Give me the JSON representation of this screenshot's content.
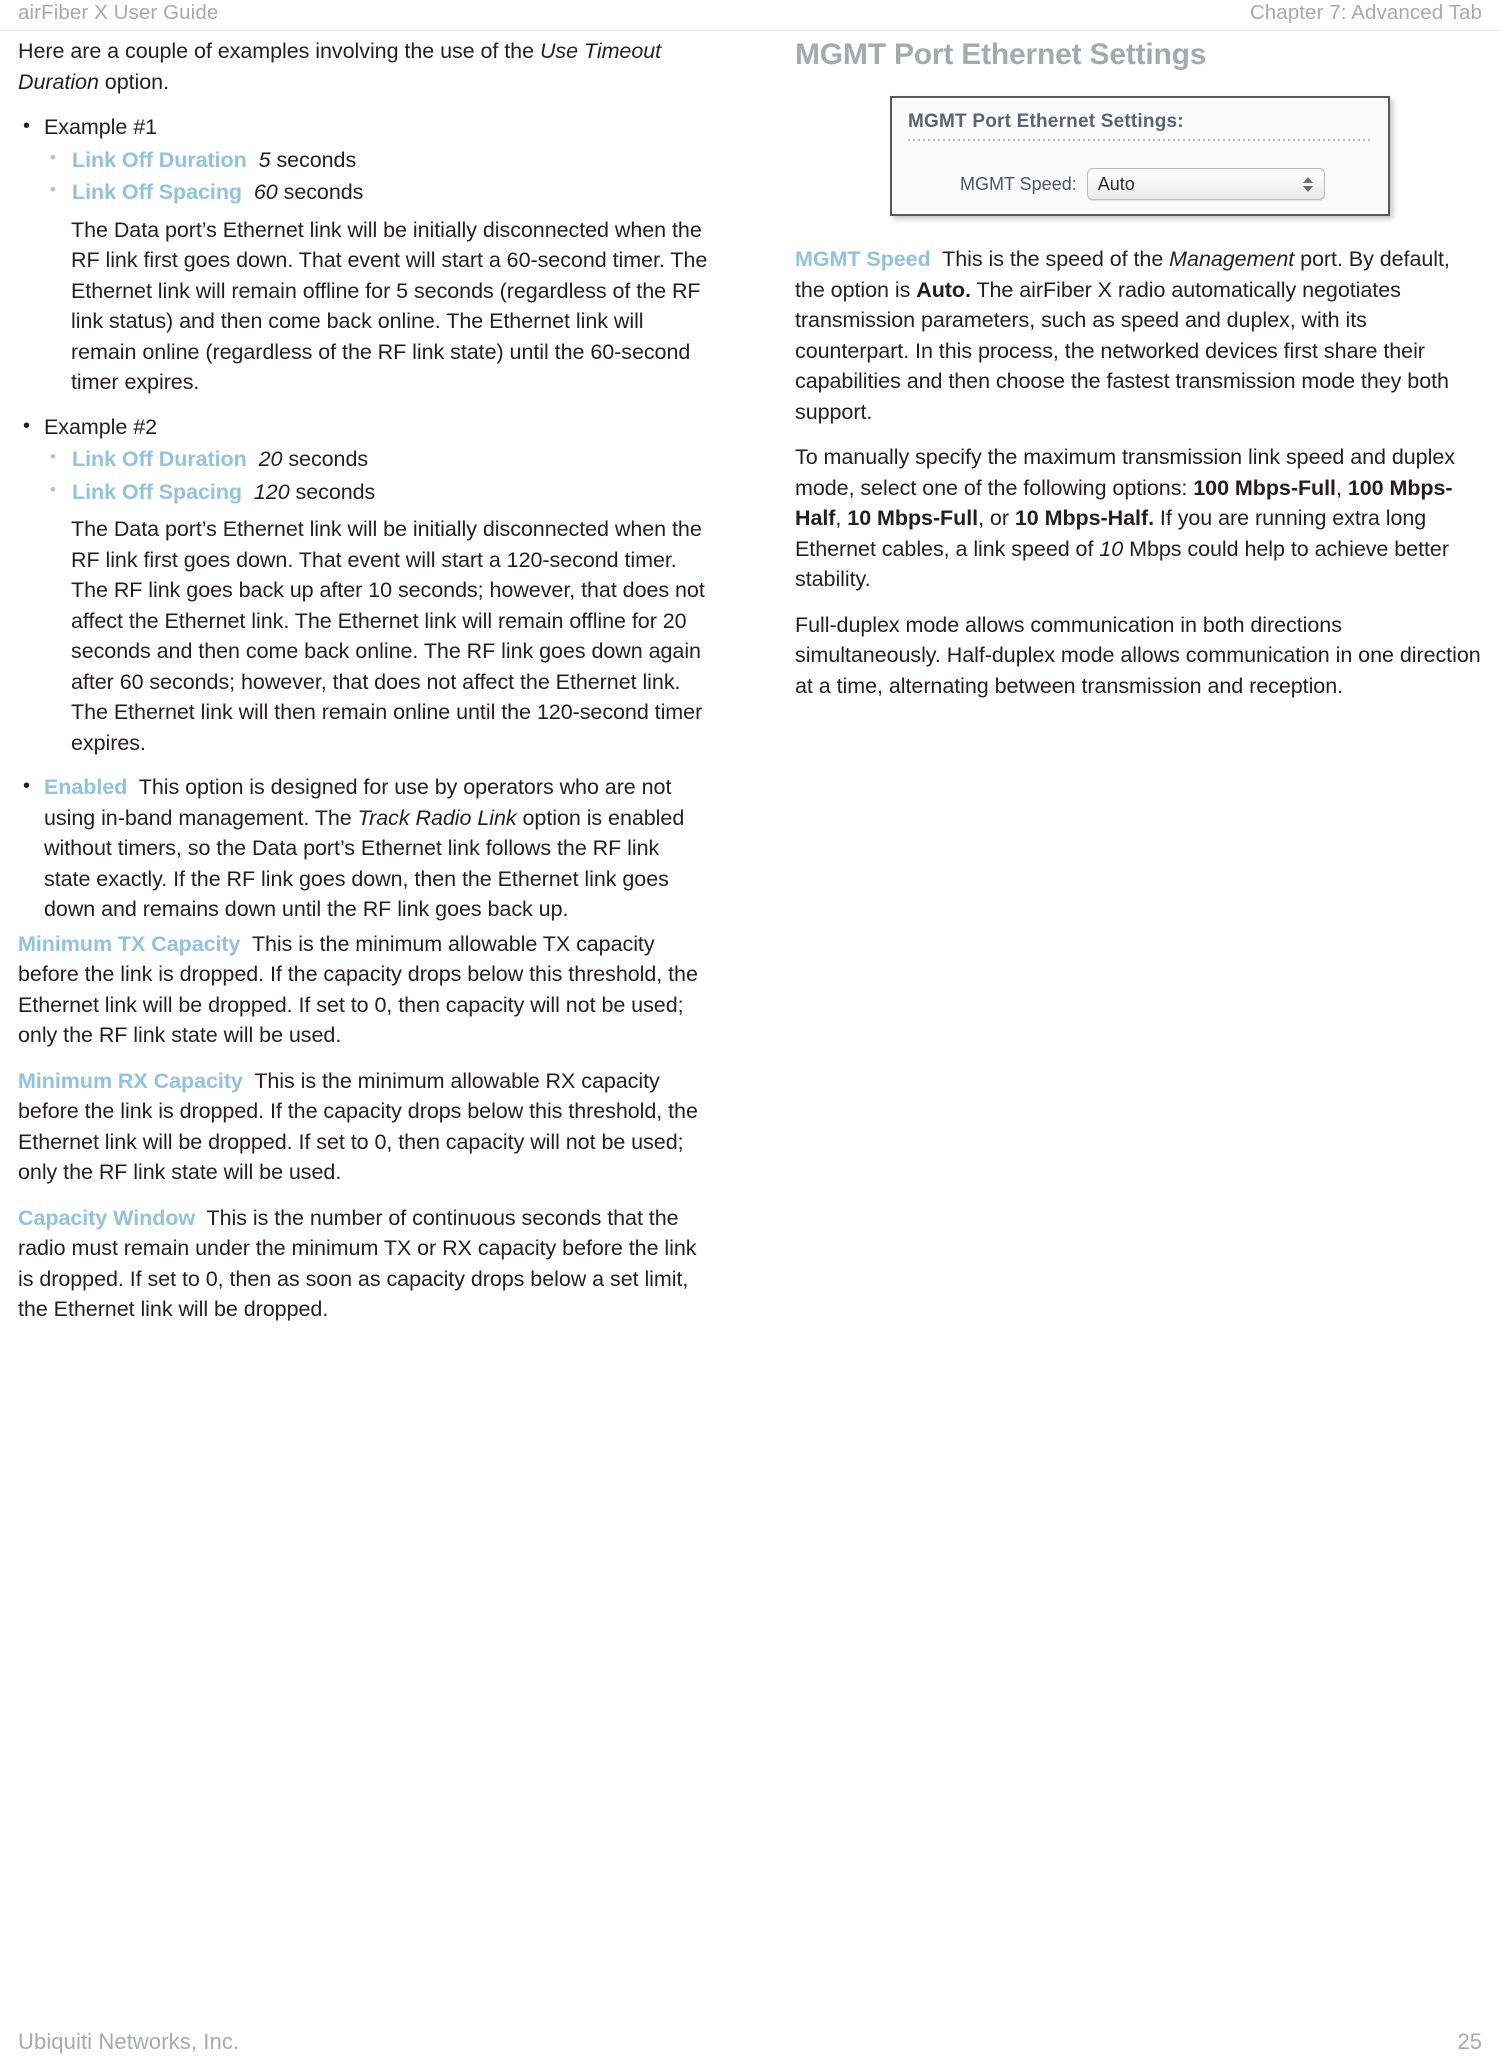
{
  "header": {
    "left": "airFiber X User Guide",
    "right": "Chapter 7: Advanced Tab"
  },
  "footer": {
    "company": "Ubiquiti Networks, Inc.",
    "page_number": "25"
  },
  "colors": {
    "accent_term": "#92c2dd",
    "heading_gray": "#a7a9ac",
    "body_text": "#231f20"
  },
  "left_column": {
    "intro": {
      "text_before_italic": "Here are a couple of examples involving the use of the ",
      "italic": "Use Timeout Duration",
      "text_after_italic": " option."
    },
    "examples": [
      {
        "label": "Example #1",
        "settings": [
          {
            "term": "Link Off Duration",
            "value": "5",
            "unit": " seconds"
          },
          {
            "term": "Link Off Spacing",
            "value": "60",
            "unit": " seconds"
          }
        ],
        "body": "The Data port’s Ethernet link will be initially disconnected when the RF link first goes down. That event will start a 60-second timer. The Ethernet link will remain offline for 5 seconds (regardless of the RF link status) and then come back online. The Ethernet link will remain online (regardless of the RF link state) until the 60-second timer expires."
      },
      {
        "label": "Example #2",
        "settings": [
          {
            "term": "Link Off Duration",
            "value": "20",
            "unit": " seconds"
          },
          {
            "term": "Link Off Spacing",
            "value": "120",
            "unit": " seconds"
          }
        ],
        "body": "The Data port’s Ethernet link will be initially disconnected when the RF link first goes down. That event will start a 120-second timer. The RF link goes back up after 10 seconds; however, that does not affect the Ethernet link. The Ethernet link will remain offline for 20 seconds and then come back online. The RF link goes down again after 60 seconds; however, that does not affect the Ethernet link. The Ethernet link will then remain online until the 120-second timer expires."
      }
    ],
    "enabled_item": {
      "term": "Enabled",
      "text_1": "This option is designed for use by operators who are not using in-band management. The ",
      "italic": "Track Radio Link",
      "text_2": " option is enabled without timers, so the Data port’s Ethernet link follows the RF link state exactly. If the RF link goes down, then the Ethernet link goes down and remains down until the RF link goes back up."
    },
    "settings": [
      {
        "term": "Minimum TX Capacity",
        "body": "This is the minimum allowable TX capacity before the link is dropped.  If the capacity drops below this threshold, the Ethernet link will be dropped. If set to 0, then capacity will not be used; only the RF link state will be used."
      },
      {
        "term": "Minimum RX Capacity",
        "body": "This is the minimum allowable RX capacity before the link is dropped.  If the capacity drops below this threshold, the Ethernet link will be dropped. If set to 0, then capacity will not be used; only the RF link state will be used."
      },
      {
        "term": "Capacity Window",
        "body": "This is the number of continuous seconds that the radio must remain under the minimum TX or RX capacity before the link is dropped.  If set to 0, then as soon as capacity drops below a set limit, the Ethernet link will be dropped."
      }
    ]
  },
  "right_column": {
    "heading": "MGMT Port Ethernet Settings",
    "screenshot": {
      "panel_title": "MGMT Port Ethernet Settings:",
      "field_label": "MGMT Speed:",
      "field_value": "Auto"
    },
    "mgmt_speed": {
      "term": "MGMT Speed",
      "text_1": "This is the speed of the ",
      "italic_1": "Management",
      "text_2": " port. By default, the option is ",
      "bold_1": "Auto.",
      "text_3": " The airFiber X radio automatically negotiates transmission parameters, such as speed and duplex, with its counterpart. In this process, the networked devices first share their capabilities and then choose the fastest transmission mode they both support."
    },
    "manual_speed": {
      "text_1": "To manually specify the maximum transmission link speed and duplex mode, select one of the following options: ",
      "option_1": "100 Mbps-Full",
      "sep_1": ", ",
      "option_2": "100 Mbps-Half",
      "sep_2": ", ",
      "option_3": "10 Mbps-Full",
      "sep_3": ", or ",
      "option_4": "10 Mbps-Half.",
      "text_2": " If you are running extra long Ethernet cables, a link speed of ",
      "italic_1": "10",
      "text_3": " Mbps could help to achieve better stability."
    },
    "duplex_paragraph": "Full-duplex mode allows communication in both directions simultaneously. Half-duplex mode allows communication in one direction at a time, alternating between transmission and reception."
  }
}
